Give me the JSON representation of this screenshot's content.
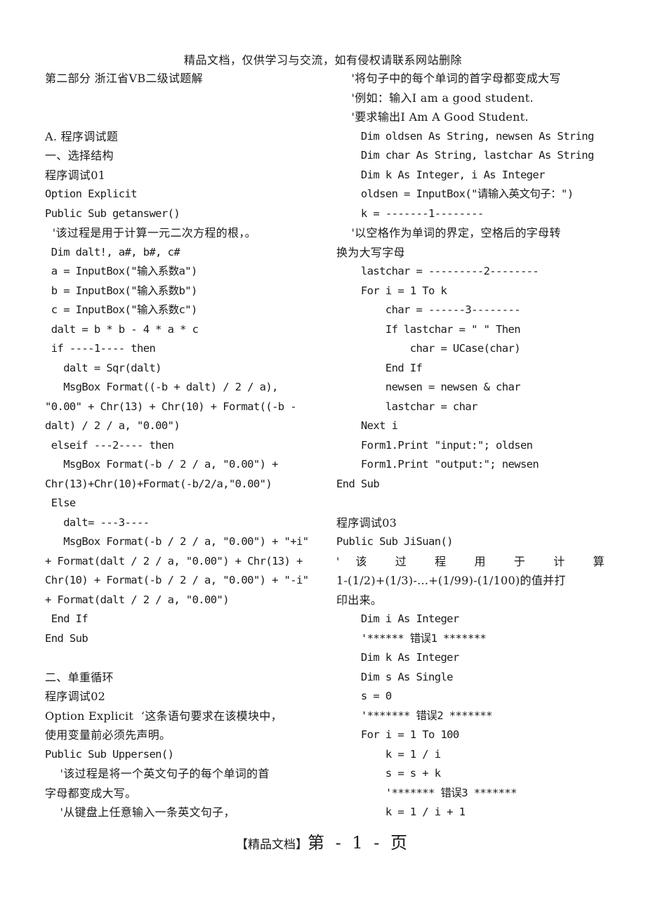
{
  "watermark": "精品文档，仅供学习与交流，如有侵权请联系网站删除",
  "left_column": [
    {
      "text": "第二部分 浙江省VB二级试题解",
      "cjk": true
    },
    {
      "text": ""
    },
    {
      "text": ""
    },
    {
      "text": "A. 程序调试题",
      "cjk": true
    },
    {
      "text": "一、选择结构",
      "cjk": true
    },
    {
      "text": "程序调试01",
      "cjk": true
    },
    {
      "text": "Option Explicit"
    },
    {
      "text": "Public Sub getanswer()"
    },
    {
      "text": "  '该过程是用于计算一元二次方程的根，。",
      "cjk": true
    },
    {
      "text": " Dim dalt!, a#, b#, c#"
    },
    {
      "text": " a = InputBox(\"输入系数a\")"
    },
    {
      "text": " b = InputBox(\"输入系数b\")"
    },
    {
      "text": " c = InputBox(\"输入系数c\")"
    },
    {
      "text": " dalt = b * b - 4 * a * c"
    },
    {
      "text": " if ----1---- then"
    },
    {
      "text": "   dalt = Sqr(dalt)"
    },
    {
      "text": "   MsgBox Format((-b + dalt) / 2 / a),"
    },
    {
      "text": "\"0.00\" + Chr(13) + Chr(10) + Format((-b -"
    },
    {
      "text": "dalt) / 2 / a, \"0.00\")"
    },
    {
      "text": " elseif ---2---- then"
    },
    {
      "text": "   MsgBox Format(-b / 2 / a, \"0.00\") +"
    },
    {
      "text": "Chr(13)+Chr(10)+Format(-b/2/a,\"0.00\")"
    },
    {
      "text": " Else"
    },
    {
      "text": "   dalt= ---3----"
    },
    {
      "text": "   MsgBox Format(-b / 2 / a, \"0.00\") + \"+i\""
    },
    {
      "text": "+ Format(dalt / 2 / a, \"0.00\") + Chr(13) +"
    },
    {
      "text": "Chr(10) + Format(-b / 2 / a, \"0.00\") + \"-i\""
    },
    {
      "text": "+ Format(dalt / 2 / a, \"0.00\")"
    },
    {
      "text": " End If"
    },
    {
      "text": "End Sub"
    },
    {
      "text": ""
    },
    {
      "text": "二、单重循环",
      "cjk": true
    },
    {
      "text": "程序调试02",
      "cjk": true
    },
    {
      "text": "Option Explicit  ‘这条语句要求在该模块中，",
      "cjk": true
    },
    {
      "text": "使用变量前必须先声明。",
      "cjk": true
    },
    {
      "text": "Public Sub Uppersen()"
    },
    {
      "text": "    '该过程是将一个英文句子的每个单词的首",
      "cjk": true
    },
    {
      "text": "字母都变成大写。",
      "cjk": true
    },
    {
      "text": "    '从键盘上任意输入一条英文句子，",
      "cjk": true
    }
  ],
  "right_column": [
    {
      "text": "    '将句子中的每个单词的首字母都变成大写",
      "cjk": true
    },
    {
      "text": "    '例如：输入I am a good student.",
      "cjk": true
    },
    {
      "text": "    '要求输出I Am A Good Student.",
      "cjk": true
    },
    {
      "text": "    Dim oldsen As String, newsen As String"
    },
    {
      "text": "    Dim char As String, lastchar As String"
    },
    {
      "text": "    Dim k As Integer, i As Integer"
    },
    {
      "text": "    oldsen = InputBox(\"请输入英文句子：\")"
    },
    {
      "text": "    k = -------1--------"
    },
    {
      "text": "    '以空格作为单词的界定，空格后的字母转",
      "cjk": true
    },
    {
      "text": "换为大写字母",
      "cjk": true
    },
    {
      "text": "    lastchar = ---------2--------"
    },
    {
      "text": "    For i = 1 To k"
    },
    {
      "text": "        char = ------3--------"
    },
    {
      "text": "        If lastchar = \" \" Then"
    },
    {
      "text": "            char = UCase(char)"
    },
    {
      "text": "        End If"
    },
    {
      "text": "        newsen = newsen & char"
    },
    {
      "text": "        lastchar = char"
    },
    {
      "text": "    Next i"
    },
    {
      "text": "    Form1.Print \"input:\"; oldsen"
    },
    {
      "text": "    Form1.Print \"output:\"; newsen"
    },
    {
      "text": "End Sub"
    },
    {
      "text": ""
    },
    {
      "text": "程序调试03",
      "cjk": true
    },
    {
      "text": "Public Sub JiSuan()"
    },
    {
      "text": "    ' 该 过 程 用 于 计 算",
      "cjk": true,
      "justify": true
    },
    {
      "text": "1-(1/2)+(1/3)-...+(1/99)-(1/100)的值并打",
      "cjk": true
    },
    {
      "text": "印出来。",
      "cjk": true
    },
    {
      "text": "    Dim i As Integer"
    },
    {
      "text": "    '****** 错误1 *******"
    },
    {
      "text": "    Dim k As Integer"
    },
    {
      "text": "    Dim s As Single"
    },
    {
      "text": "    s = 0"
    },
    {
      "text": "    '******* 错误2 *******"
    },
    {
      "text": "    For i = 1 To 100"
    },
    {
      "text": "        k = 1 / i"
    },
    {
      "text": "        s = s + k"
    },
    {
      "text": "        '******* 错误3 *******"
    },
    {
      "text": "        k = 1 / i + 1"
    }
  ],
  "footer": {
    "brand": "【精品文档】",
    "page_label": "第 - 1 - 页"
  }
}
